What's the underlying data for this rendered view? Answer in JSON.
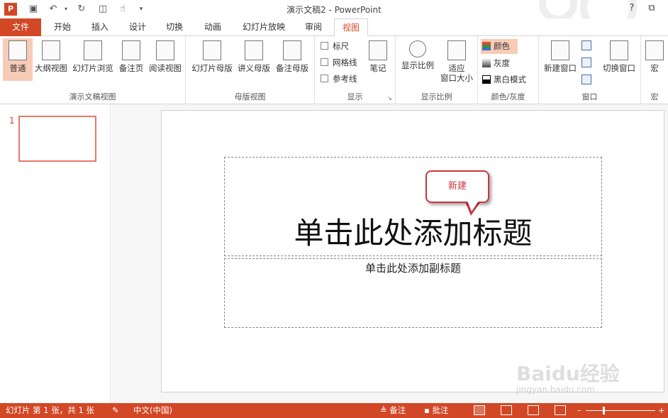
{
  "window": {
    "title": "演示文稿2 - PowerPoint",
    "app_icon": "P",
    "help": "?"
  },
  "tabs": [
    "文件",
    "开始",
    "插入",
    "设计",
    "切换",
    "动画",
    "幻灯片放映",
    "审阅",
    "视图"
  ],
  "active_tab": "视图",
  "ribbon": {
    "presentation_views": {
      "label": "演示文稿视图",
      "buttons": [
        "普通",
        "大纲视图",
        "幻灯片浏览",
        "备注页",
        "阅读视图"
      ]
    },
    "master_views": {
      "label": "母版视图",
      "buttons": [
        "幻灯片母版",
        "讲义母版",
        "备注母版"
      ]
    },
    "show": {
      "label": "显示",
      "checkboxes": [
        "标尺",
        "网格线",
        "参考线"
      ],
      "notes": "笔记"
    },
    "zoom": {
      "label": "显示比例",
      "zoom_btn": "显示比例",
      "fit_btn_line1": "适应",
      "fit_btn_line2": "窗口大小"
    },
    "color": {
      "label": "颜色/灰度",
      "options": [
        "颜色",
        "灰度",
        "黑白模式"
      ]
    },
    "window": {
      "label": "窗口",
      "new_window": "新建窗口",
      "switch_window": "切换窗口"
    },
    "macro": {
      "label": "宏",
      "btn": "宏"
    }
  },
  "slides_pane": {
    "slide_number": "1"
  },
  "slide": {
    "title_placeholder": "单击此处添加标题",
    "subtitle_placeholder": "单击此处添加副标题",
    "callout_text": "新建"
  },
  "statusbar": {
    "slide_info": "幻灯片 第 1 张，共 1 张",
    "language": "中文(中国)",
    "notes": "备注",
    "comments": "批注"
  },
  "watermark": {
    "main": "Baidu经验",
    "sub": "jingyan.baidu.com"
  }
}
